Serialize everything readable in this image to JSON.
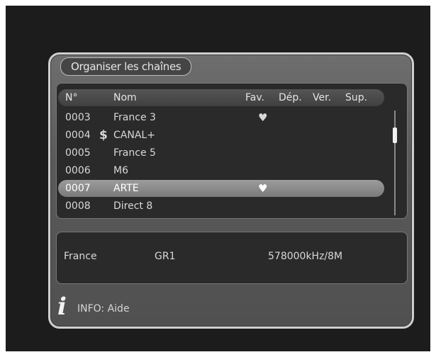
{
  "title": "Organiser les chaînes",
  "columns": {
    "num": "N°",
    "name": "Nom",
    "fav": "Fav.",
    "dep": "Dép.",
    "ver": "Ver.",
    "sup": "Sup."
  },
  "channels": [
    {
      "num": "0003",
      "name": "France 3",
      "fav": "♥",
      "pay": ""
    },
    {
      "num": "0004",
      "name": "CANAL+",
      "fav": "",
      "pay": "$"
    },
    {
      "num": "0005",
      "name": "France 5",
      "fav": "",
      "pay": ""
    },
    {
      "num": "0006",
      "name": "M6",
      "fav": "",
      "pay": ""
    },
    {
      "num": "0007",
      "name": "ARTE",
      "fav": "♥",
      "pay": ""
    },
    {
      "num": "0008",
      "name": "Direct 8",
      "fav": "",
      "pay": ""
    }
  ],
  "selected_index": 4,
  "details": {
    "country": "France",
    "group": "GR1",
    "frequency": "578000kHz/8M"
  },
  "footer": {
    "icon": "info-icon",
    "icon_glyph": "i",
    "help": "INFO: Aide"
  }
}
